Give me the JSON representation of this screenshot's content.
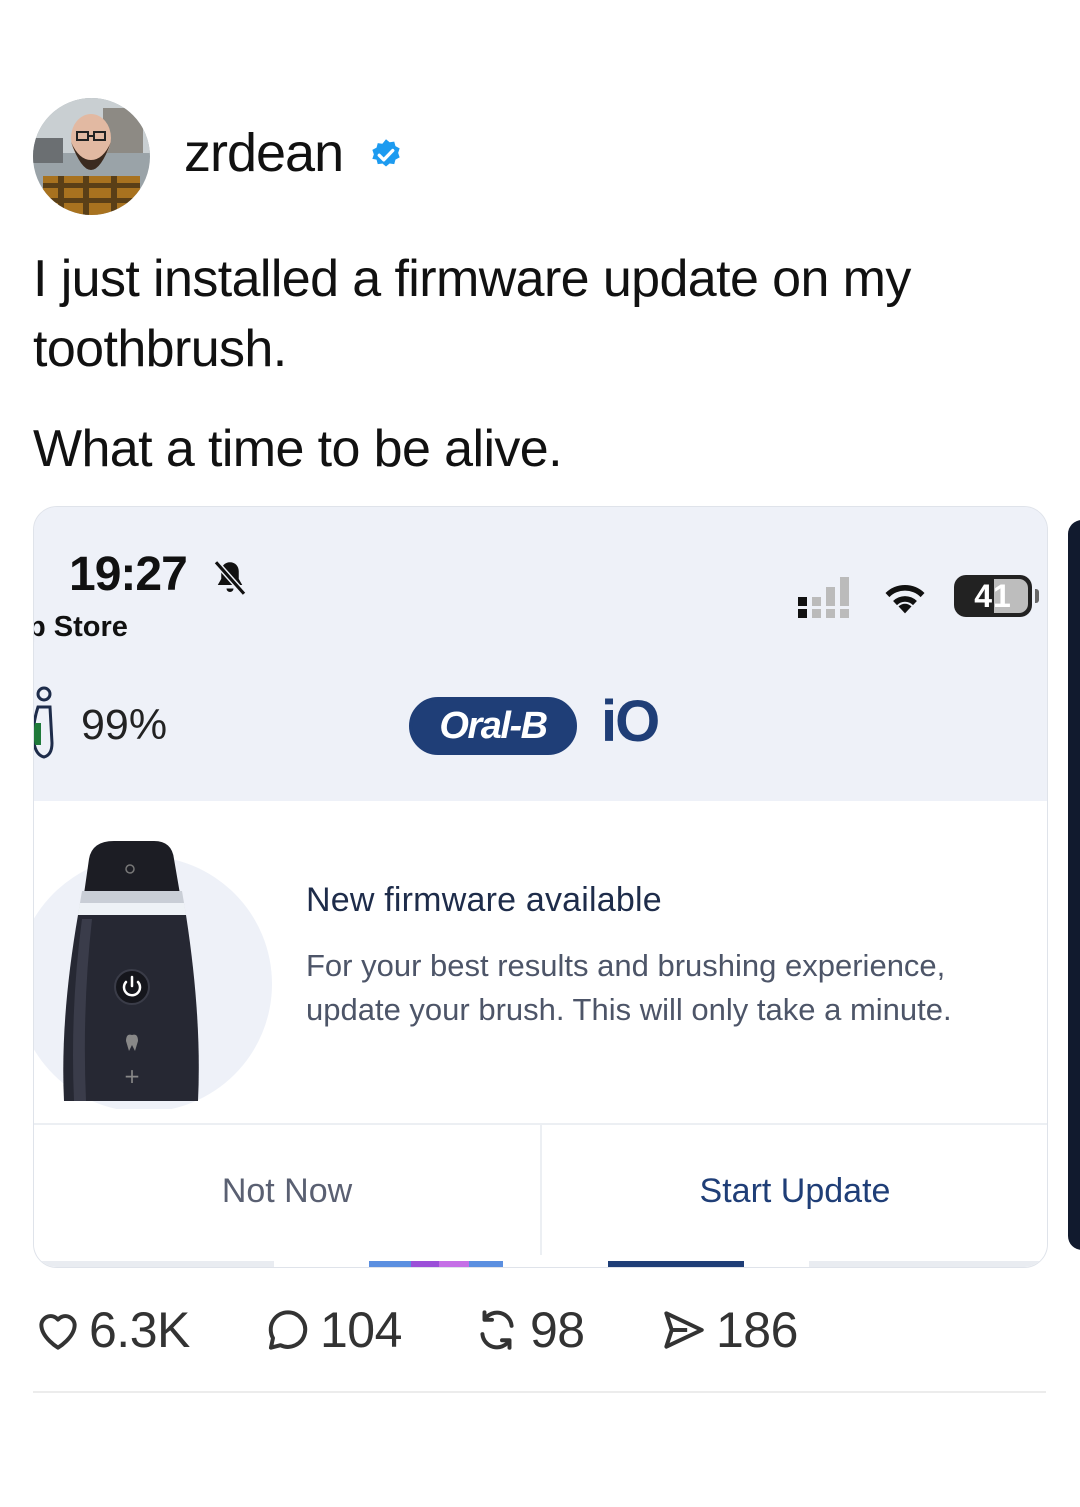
{
  "post": {
    "username": "zrdean",
    "verified": true,
    "text_line1": "I just installed a firmware update on my toothbrush.",
    "text_line2": "What a time to be alive."
  },
  "screenshot": {
    "status_bar": {
      "time": "19:27",
      "back_app": "p Store",
      "battery": "41",
      "icons": [
        "bell-slash-icon",
        "signal-icon",
        "wifi-icon",
        "battery-icon"
      ]
    },
    "app_header": {
      "brush_battery": "99%",
      "brand": "Oral-B",
      "brand_suffix": "iO"
    },
    "dialog": {
      "title": "New firmware available",
      "body": "For your best results and brushing experience, update your brush. This will only take a minute.",
      "secondary_button": "Not Now",
      "primary_button": "Start Update"
    },
    "colors": {
      "brand_blue": "#1f3e77",
      "header_bg": "#eef1f8",
      "verified_blue": "#1d9bf0"
    }
  },
  "actions": {
    "likes": "6.3K",
    "replies": "104",
    "reposts": "98",
    "shares": "186"
  }
}
